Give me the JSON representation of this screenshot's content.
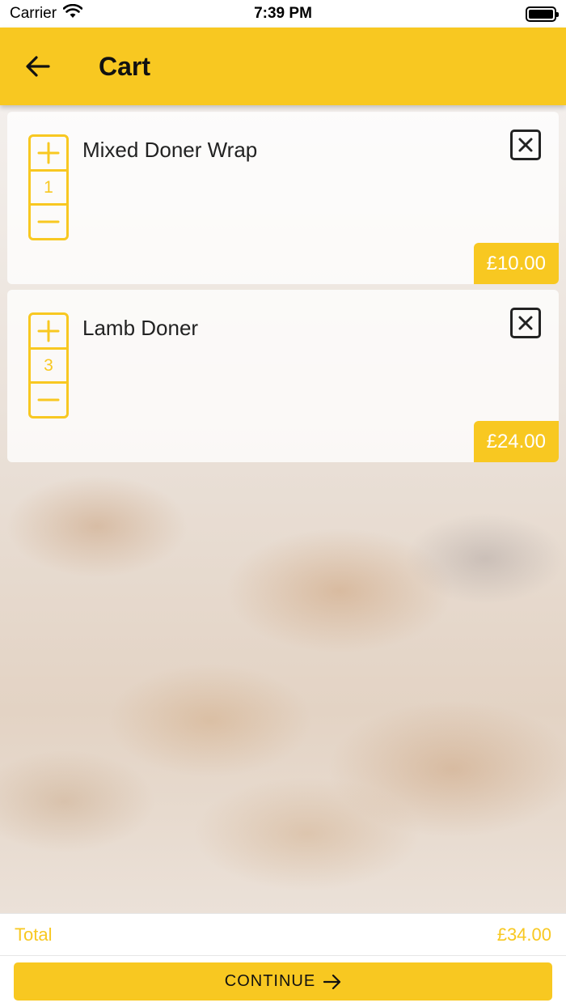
{
  "status_bar": {
    "carrier": "Carrier",
    "time": "7:39 PM",
    "icons": [
      "wifi-icon",
      "battery-icon"
    ]
  },
  "header": {
    "title": "Cart",
    "back_icon": "arrow-left-icon",
    "background_color": "#f8c821"
  },
  "cart": {
    "items": [
      {
        "name": "Mixed Doner Wrap",
        "quantity": "1",
        "price": "£10.00"
      },
      {
        "name": "Lamb Doner",
        "quantity": "3",
        "price": "£24.00"
      }
    ]
  },
  "summary": {
    "total_label": "Total",
    "total_value": "£34.00"
  },
  "footer": {
    "continue_label": "CONTINUE",
    "continue_icon": "arrow-right-icon"
  },
  "colors": {
    "accent": "#f8c821"
  }
}
